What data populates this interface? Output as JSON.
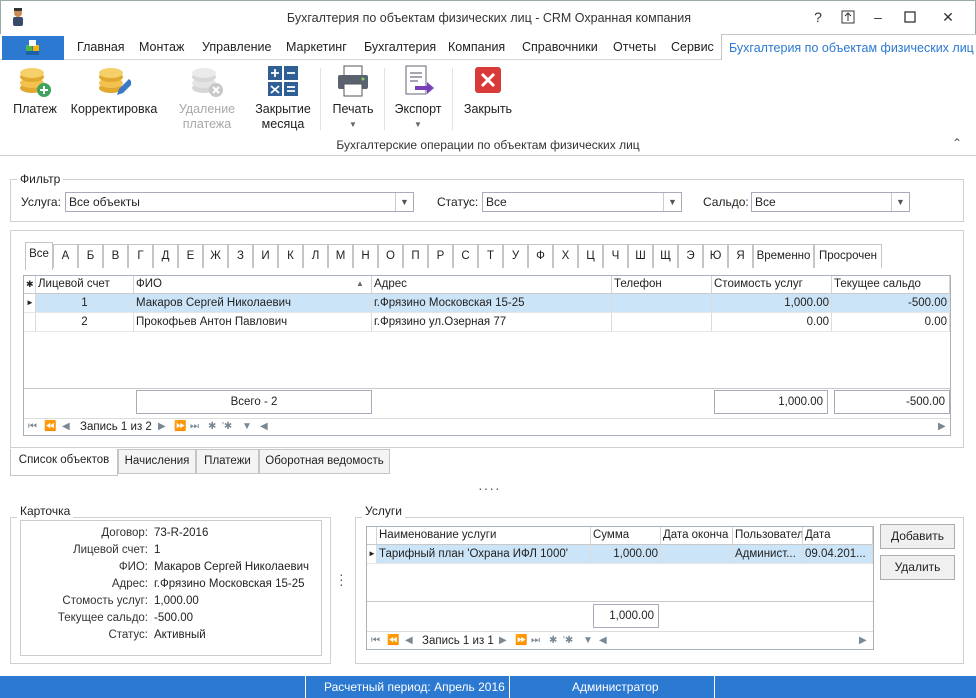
{
  "window": {
    "title": "Бухгалтерия по объектам физических лиц - CRM Охранная компания",
    "help": "?"
  },
  "menu": {
    "items": [
      "Главная",
      "Монтаж",
      "Управление",
      "Маркетинг",
      "Бухгалтерия",
      "Компания",
      "Справочники",
      "Отчеты",
      "Сервис"
    ],
    "active": "Бухгалтерия по объектам физических лиц"
  },
  "ribbon": {
    "payment": "Платеж",
    "correction": "Корректировка",
    "delete_payment": "Удаление платежа",
    "close_month": "Закрытие месяца",
    "print": "Печать",
    "export": "Экспорт",
    "close": "Закрыть",
    "group_label": "Бухгалтерские операции по объектам физических лиц"
  },
  "filter": {
    "legend": "Фильтр",
    "service_label": "Услуга:",
    "service_value": "Все объекты",
    "status_label": "Статус:",
    "status_value": "Все",
    "saldo_label": "Сальдо:",
    "saldo_value": "Все"
  },
  "letter_tabs": [
    "Все",
    "А",
    "Б",
    "В",
    "Г",
    "Д",
    "Е",
    "Ж",
    "З",
    "И",
    "К",
    "Л",
    "М",
    "Н",
    "О",
    "П",
    "Р",
    "С",
    "Т",
    "У",
    "Ф",
    "Х",
    "Ц",
    "Ч",
    "Ш",
    "Щ",
    "Э",
    "Ю",
    "Я",
    "Временно",
    "Просрочен"
  ],
  "main_grid": {
    "columns": [
      "Лицевой счет",
      "ФИО",
      "Адрес",
      "Телефон",
      "Стоимость услуг",
      "Текущее сальдо"
    ],
    "rows": [
      [
        "1",
        "Макаров Сергей Николаевич",
        "г.Фрязино Московская 15-25",
        "",
        "1,000.00",
        "-500.00"
      ],
      [
        "2",
        "Прокофьев Антон Павлович",
        "г.Фрязино ул.Озерная 77",
        "",
        "0.00",
        "0.00"
      ]
    ],
    "summary": {
      "count": "Всего - 2",
      "cost": "1,000.00",
      "saldo": "-500.00"
    },
    "nav_text": "Запись 1 из 2"
  },
  "bottom_tabs": [
    "Список объектов",
    "Начисления",
    "Платежи",
    "Оборотная ведомость"
  ],
  "card": {
    "legend": "Карточка",
    "fields": [
      {
        "label": "Договор:",
        "value": "73-R-2016"
      },
      {
        "label": "Лицевой счет:",
        "value": "1"
      },
      {
        "label": "ФИО:",
        "value": "Макаров Сергей Николаевич"
      },
      {
        "label": "Адрес:",
        "value": "г.Фрязино Московская 15-25"
      },
      {
        "label": "Стомость услуг:",
        "value": "1,000.00"
      },
      {
        "label": "Текущее сальдо:",
        "value": "-500.00"
      },
      {
        "label": "Статус:",
        "value": "Активный"
      }
    ]
  },
  "services": {
    "legend": "Услуги",
    "columns": [
      "Наименование услуги",
      "Сумма",
      "Дата оконча",
      "Пользовател",
      "Дата"
    ],
    "rows": [
      [
        "Тарифный план 'Охрана ИФЛ 1000'",
        "1,000.00",
        "",
        "Админист...",
        "09.04.201..."
      ]
    ],
    "summary": "1,000.00",
    "nav_text": "Запись 1 из 1",
    "add_button": "Добавить",
    "delete_button": "Удалить"
  },
  "status": {
    "period": "Расчетный период: Апрель 2016",
    "user": "Администратор"
  },
  "colors": {
    "accent": "#2b79d1",
    "selected_row": "#cce4f7"
  }
}
